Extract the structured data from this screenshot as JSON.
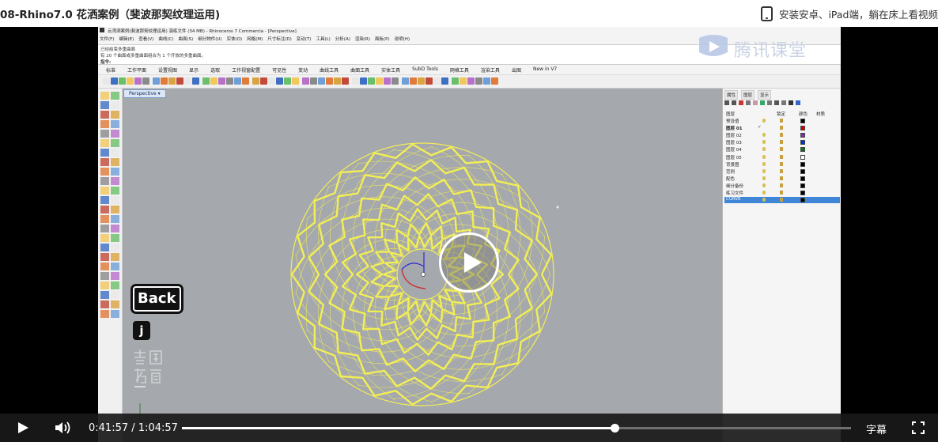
{
  "header": {
    "course_title": "08-Rhino7.0 花洒案例（斐波那契纹理运用)",
    "promo_text": "安装安卓、iPad端，躺在床上看视频",
    "promo_icon": "tablet-icon"
  },
  "rhino": {
    "window_title": "云湾洒案例(斐波那契纹理运用)   演练文件 (34 MB) - Rhinoceros 7 Commercia - [Perspective]",
    "menus": [
      "文件(F)",
      "编辑(E)",
      "查看(V)",
      "曲线(C)",
      "曲面(S)",
      "细分物件(U)",
      "实体(O)",
      "网格(M)",
      "尺寸标注(D)",
      "变动(T)",
      "工具(L)",
      "分析(A)",
      "渲染(R)",
      "面板(P)",
      "说明(H)"
    ],
    "cmd_history_1": "已经结束多重曲面",
    "cmd_history_2": "有 20 个曲面或多重曲面组合为 1 个开放的多重曲面。",
    "cmd_prompt": "指令:",
    "toolbar_tabs": [
      "标准",
      "工作平面",
      "设置视图",
      "显示",
      "选取",
      "工作视窗配置",
      "可见性",
      "变动",
      "曲线工具",
      "曲面工具",
      "实体工具",
      "SubD Tools",
      "网格工具",
      "渲染工具",
      "出图",
      "New in V7"
    ],
    "viewport_label": "Perspective",
    "panel_tabs": [
      "属性",
      "图层",
      "显示"
    ],
    "layer_columns": [
      "图层",
      "锁定",
      "颜色",
      "材质"
    ],
    "layers": [
      {
        "name": "预设值",
        "color": "#000000",
        "current": false,
        "selected": false,
        "bold": false
      },
      {
        "name": "图层 01",
        "color": "#cc0000",
        "current": true,
        "selected": false,
        "bold": true
      },
      {
        "name": "图层 02",
        "color": "#7b2fb5",
        "current": false,
        "selected": false,
        "bold": false
      },
      {
        "name": "图层 03",
        "color": "#0033cc",
        "current": false,
        "selected": false,
        "bold": false
      },
      {
        "name": "图层 04",
        "color": "#0a7a16",
        "current": false,
        "selected": false,
        "bold": false
      },
      {
        "name": "图层 05",
        "color": "#ffffff",
        "current": false,
        "selected": false,
        "bold": false
      },
      {
        "name": "背景图",
        "color": "#000000",
        "current": false,
        "selected": false,
        "bold": false
      },
      {
        "name": "范例",
        "color": "#000000",
        "current": false,
        "selected": false,
        "bold": false
      },
      {
        "name": "配色",
        "color": "#000000",
        "current": false,
        "selected": false,
        "bold": false
      },
      {
        "name": "细分备份",
        "color": "#000000",
        "current": false,
        "selected": false,
        "bold": false
      },
      {
        "name": "练习文件",
        "color": "#000000",
        "current": false,
        "selected": false,
        "bold": false
      },
      {
        "name": "CURVE",
        "color": "#000000",
        "current": false,
        "selected": true,
        "bold": false
      }
    ],
    "current_mark": "✓",
    "pattern_color": "#f2ee55"
  },
  "overlays": {
    "watermark_text": "腾讯课堂",
    "key_back": "Back",
    "key_j": "j",
    "brand_mark": "云尚教育"
  },
  "player": {
    "current_time": "0:41:57",
    "separator": "/",
    "duration": "1:04:57",
    "progress": 0.646,
    "subtitle_label": "字幕",
    "colors": {
      "bar": "#1a1a1a",
      "progress_fill": "#ffffff",
      "progress_track": "#6f6f6f"
    }
  }
}
